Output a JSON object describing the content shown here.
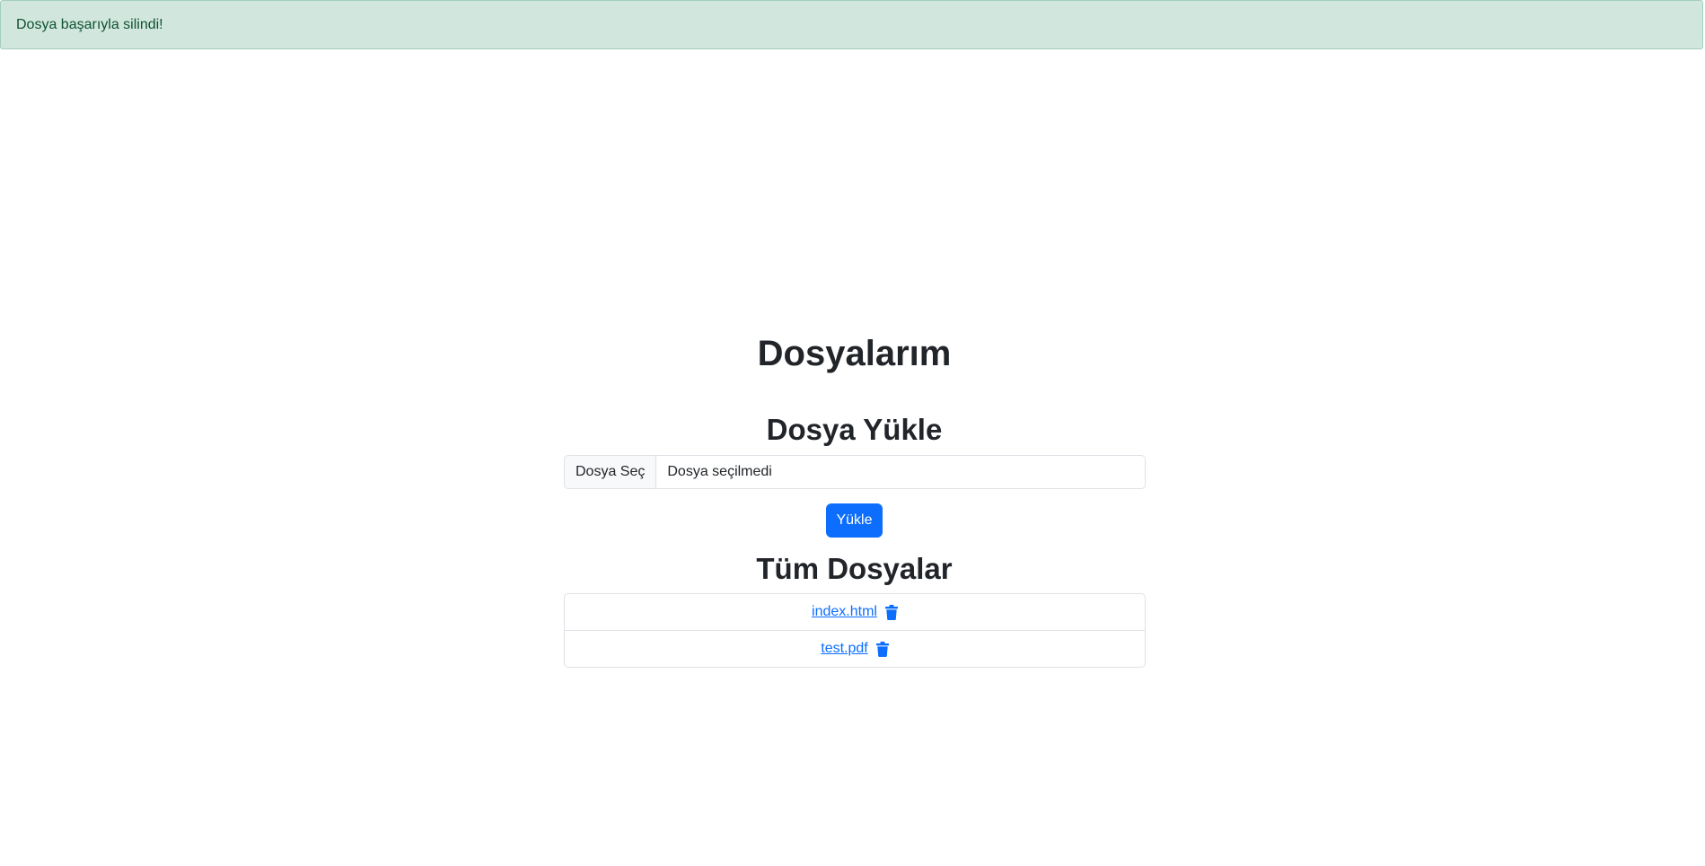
{
  "alert": {
    "message": "Dosya başarıyla silindi!"
  },
  "page": {
    "title": "Dosyalarım"
  },
  "upload": {
    "heading": "Dosya Yükle",
    "choose_label": "Dosya Seç",
    "no_file_label": "Dosya seçilmedi",
    "submit_label": "Yükle"
  },
  "files": {
    "heading": "Tüm Dosyalar",
    "items": [
      {
        "name": "index.html",
        "delete_icon": "trash-icon"
      },
      {
        "name": "test.pdf",
        "delete_icon": "trash-icon"
      }
    ]
  },
  "colors": {
    "primary": "#0d6efd",
    "alert_bg": "#d1e7dd",
    "alert_border": "#a3cfbb",
    "alert_text": "#0f5132",
    "border": "#dee2e6"
  }
}
